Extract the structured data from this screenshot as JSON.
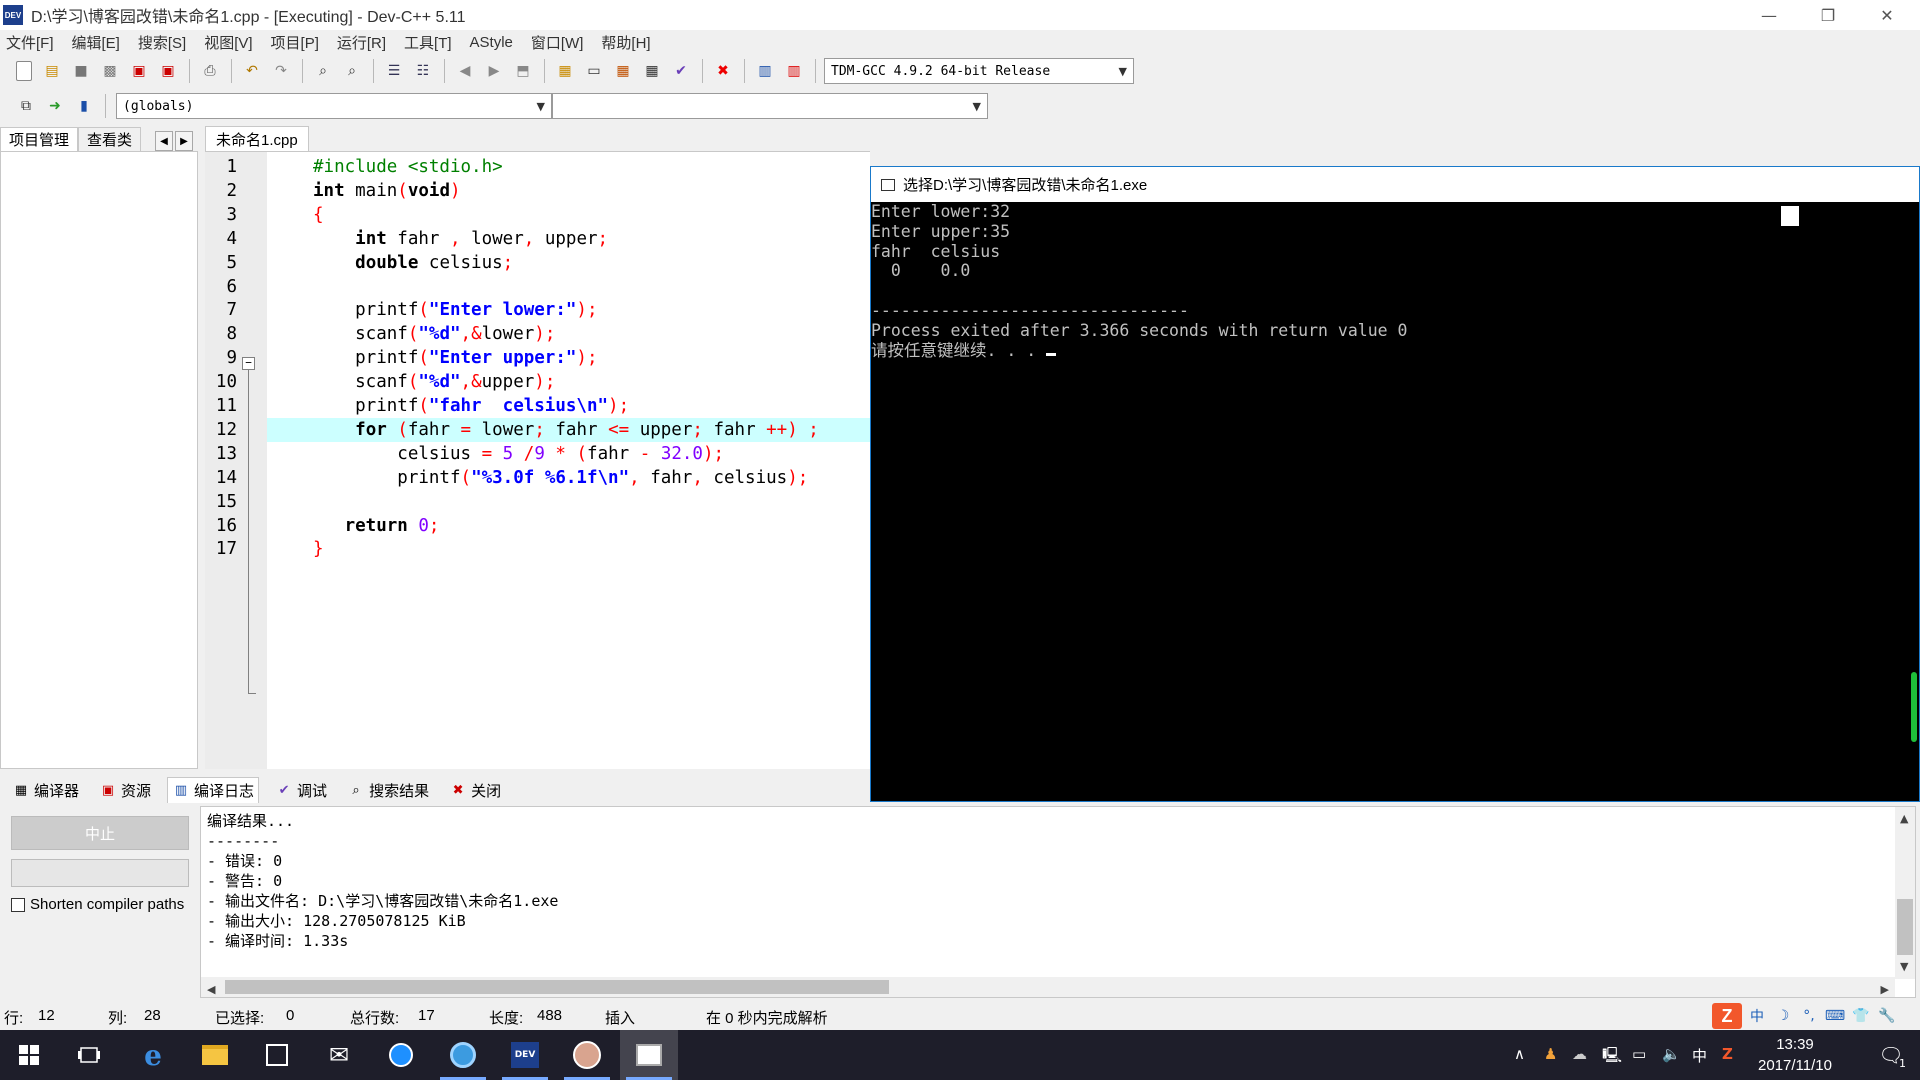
{
  "window": {
    "title": "D:\\学习\\博客园改错\\未命名1.cpp - [Executing] - Dev-C++ 5.11",
    "app_icon_text": "DEV",
    "minimize": "—",
    "maximize": "❐",
    "close": "✕"
  },
  "menu": [
    "文件[F]",
    "编辑[E]",
    "搜索[S]",
    "视图[V]",
    "项目[P]",
    "运行[R]",
    "工具[T]",
    "AStyle",
    "窗口[W]",
    "帮助[H]"
  ],
  "toolbar": {
    "compiler_select": "TDM-GCC 4.9.2 64-bit Release",
    "scope_select": "(globals)",
    "symbol_select": ""
  },
  "left_panel": {
    "tabs": [
      "项目管理",
      "查看类"
    ],
    "prev": "◀",
    "next": "▶"
  },
  "editor": {
    "tab": "未命名1.cpp",
    "fold_marker": "−",
    "lines": [
      {
        "n": "1",
        "html": "<span class='pp'>#include &lt;stdio.h&gt;</span>"
      },
      {
        "n": "2",
        "html": "<span class='kw'>int</span> main<span class='sym'>(</span><span class='kw'>void</span><span class='sym'>)</span>"
      },
      {
        "n": "3",
        "html": "<span class='sym'>{</span>"
      },
      {
        "n": "4",
        "html": "    <span class='kw'>int</span> fahr <span class='sym'>,</span> lower<span class='sym'>,</span> upper<span class='sym'>;</span>"
      },
      {
        "n": "5",
        "html": "    <span class='kw'>double</span> celsius<span class='sym'>;</span>"
      },
      {
        "n": "6",
        "html": ""
      },
      {
        "n": "7",
        "html": "    printf<span class='sym'>(</span><span class='str'>\"Enter lower:\"</span><span class='sym'>);</span>"
      },
      {
        "n": "8",
        "html": "    scanf<span class='sym'>(</span><span class='str'>\"%d\"</span><span class='sym'>,&amp;</span>lower<span class='sym'>);</span>"
      },
      {
        "n": "9",
        "html": "    printf<span class='sym'>(</span><span class='str'>\"Enter upper:\"</span><span class='sym'>);</span>"
      },
      {
        "n": "10",
        "html": "    scanf<span class='sym'>(</span><span class='str'>\"%d\"</span><span class='sym'>,&amp;</span>upper<span class='sym'>);</span>"
      },
      {
        "n": "11",
        "html": "    printf<span class='sym'>(</span><span class='str'>\"fahr  celsius\\n\"</span><span class='sym'>);</span>"
      },
      {
        "n": "12",
        "html": "    <span class='kw'>for</span> <span class='sym'>(</span>fahr <span class='sym'>=</span> lower<span class='sym'>;</span> fahr <span class='sym'>&lt;=</span> upper<span class='sym'>;</span> fahr <span class='sym'>++)</span> <span class='sym'>;</span>",
        "highlight": true
      },
      {
        "n": "13",
        "html": "        celsius <span class='sym'>=</span> <span class='num'>5</span> <span class='sym'>/</span><span class='num'>9</span> <span class='sym'>*</span> <span class='sym'>(</span>fahr <span class='sym'>-</span> <span class='num'>32.0</span><span class='sym'>);</span>"
      },
      {
        "n": "14",
        "html": "        printf<span class='sym'>(</span><span class='str'>\"%3.0f %6.1f\\n\"</span><span class='sym'>,</span> fahr<span class='sym'>,</span> celsius<span class='sym'>);</span>"
      },
      {
        "n": "15",
        "html": ""
      },
      {
        "n": "16",
        "html": "   <span class='kw'>return</span> <span class='num'>0</span><span class='sym'>;</span>"
      },
      {
        "n": "17",
        "html": "<span class='sym'>}</span>"
      }
    ]
  },
  "console": {
    "title": "选择D:\\学习\\博客园改错\\未命名1.exe",
    "lines": [
      "Enter lower:32",
      "Enter upper:35",
      "fahr  celsius",
      "  0    0.0",
      "",
      "--------------------------------",
      "Process exited after 3.366 seconds with return value 0",
      "请按任意键继续. . . "
    ]
  },
  "bottom_tabs": [
    {
      "icon": "▦",
      "label": "编译器"
    },
    {
      "icon": "▣",
      "label": "资源"
    },
    {
      "icon": "▥",
      "label": "编译日志",
      "active": true
    },
    {
      "icon": "✔",
      "label": "调试"
    },
    {
      "icon": "⌕",
      "label": "搜索结果"
    },
    {
      "icon": "✖",
      "label": "关闭"
    }
  ],
  "compile": {
    "abort_label": "中止",
    "shorten_label": "Shorten compiler paths",
    "log": [
      "编译结果...",
      "--------",
      "- 错误: 0",
      "- 警告: 0",
      "- 输出文件名: D:\\学习\\博客园改错\\未命名1.exe",
      "- 输出大小: 128.2705078125 KiB",
      "- 编译时间: 1.33s"
    ]
  },
  "status": {
    "row_label": "行:",
    "row_value": "12",
    "col_label": "列:",
    "col_value": "28",
    "sel_label": "已选择:",
    "sel_value": "0",
    "total_label": "总行数:",
    "total_value": "17",
    "len_label": "长度:",
    "len_value": "488",
    "mode": "插入",
    "parse_msg": "在 0 秒内完成解析"
  },
  "ime": {
    "logo": "Z",
    "items": [
      "中",
      "☽",
      "°,",
      "⌨",
      "👕",
      "🔧"
    ]
  },
  "taskbar": {
    "tray_chevron": "∧",
    "ime_char": "中",
    "time": "13:39",
    "date": "2017/11/10",
    "notification_count": "1"
  },
  "colors": {
    "highlight_line": "#ccffff",
    "console_bg": "#000000",
    "keyword": "#000000",
    "string": "#0000ff",
    "symbol": "#ff0000",
    "number": "#8000ff",
    "preprocessor": "#008000"
  }
}
